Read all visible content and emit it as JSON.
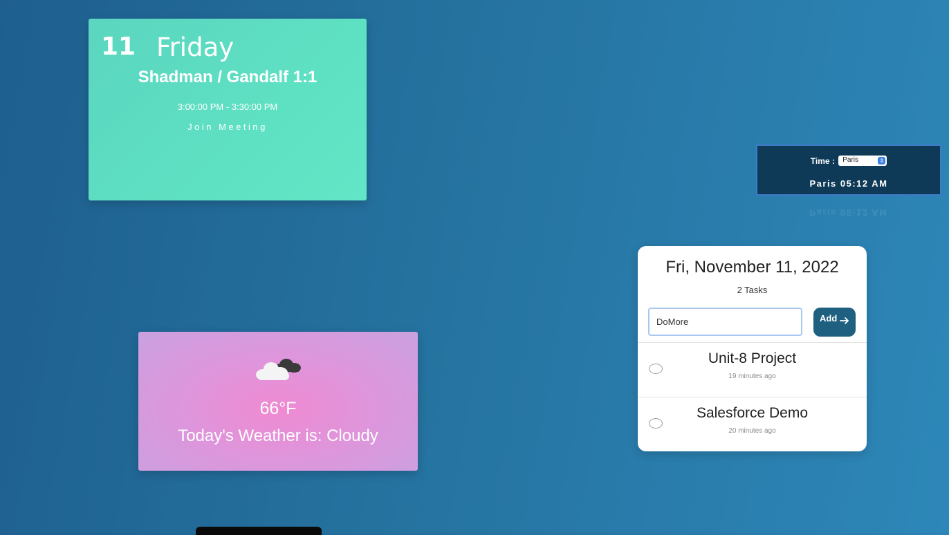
{
  "meeting": {
    "day_number": "11",
    "weekday": "Friday",
    "title": "Shadman / Gandalf 1:1",
    "time_range": "3:00:00 PM - 3:30:00 PM",
    "join_label": "Join Meeting",
    "background_color": "#5ee0c2"
  },
  "clock": {
    "label": "Time :",
    "timezone_selected": "Paris",
    "display": "Paris 05:12 AM",
    "background_color": "#0f3a57",
    "border_color": "#3f79c9"
  },
  "weather": {
    "icon": "cloudy-icon",
    "temperature": "66°F",
    "description": "Today's Weather is: Cloudy",
    "background_color": "#ef8ad2"
  },
  "todo": {
    "date": "Fri, November 11, 2022",
    "task_count": "2 Tasks",
    "input_value": "DoMore",
    "add_label": "Add",
    "add_icon": "arrow-right-icon",
    "accent_color": "#1f5f7f",
    "items": [
      {
        "title": "Unit-8 Project",
        "time_ago": "19 minutes ago",
        "done": false
      },
      {
        "title": "Salesforce Demo",
        "time_ago": "20 minutes ago",
        "done": false
      }
    ]
  }
}
